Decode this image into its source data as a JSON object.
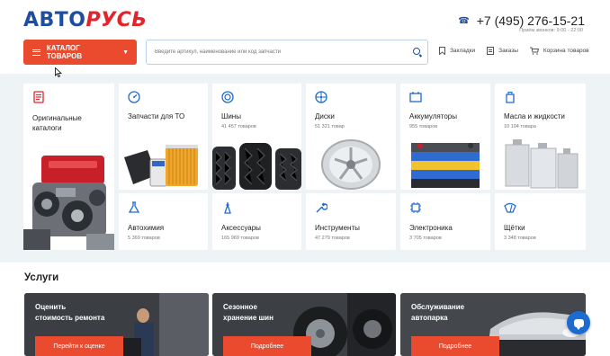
{
  "header": {
    "logo_part1": "АВТО",
    "logo_part2": "РУСЬ",
    "phone": "+7 (495) 276-15-21",
    "hours": "Приём звонков: 9:00 - 22:00",
    "catalog_button": "КАТАЛОГ ТОВАРОВ",
    "search_placeholder": "Введите артикул, наименование или код запчасти",
    "links": {
      "bookmarks": "Закладки",
      "orders": "Заказы",
      "cart": "Корзина товаров"
    }
  },
  "categories": [
    {
      "name": "Оригинальные",
      "name2": "каталоги",
      "icon": "catalog-icon"
    },
    {
      "name": "Запчасти для ТО",
      "icon": "gauge-icon"
    },
    {
      "name": "Шины",
      "count": "41 457 товаров",
      "icon": "tire-icon"
    },
    {
      "name": "Диски",
      "count": "51 321 товар",
      "icon": "wheel-icon"
    },
    {
      "name": "Аккумуляторы",
      "count": "955 товаров",
      "icon": "battery-icon"
    },
    {
      "name": "Масла и жидкости",
      "count": "10 104 товара",
      "icon": "oil-icon"
    },
    {
      "name": "Автохимия",
      "count": "5 369 товаров",
      "icon": "flask-icon"
    },
    {
      "name": "Аксессуары",
      "count": "165 969 товаров",
      "icon": "accessory-icon"
    },
    {
      "name": "Инструменты",
      "count": "47 279 товаров",
      "icon": "wrench-icon"
    },
    {
      "name": "Электроника",
      "count": "3 705 товаров",
      "icon": "chip-icon"
    },
    {
      "name": "Щётки",
      "count": "3 348 товаров",
      "icon": "wiper-icon"
    }
  ],
  "services": {
    "title": "Услуги",
    "items": [
      {
        "line1": "Оценить",
        "line2": "стоимость ремонта",
        "button": "Перейти к оценке"
      },
      {
        "line1": "Сезонное",
        "line2": "хранение шин",
        "button": "Подробнее"
      },
      {
        "line1": "Обслуживание",
        "line2": "автопарка",
        "button": "Подробнее"
      }
    ]
  },
  "colors": {
    "accent": "#ea4a2d",
    "brand_blue": "#1f4ea1",
    "icon_blue": "#1e6bd0",
    "background_grey": "#eef3f6"
  }
}
